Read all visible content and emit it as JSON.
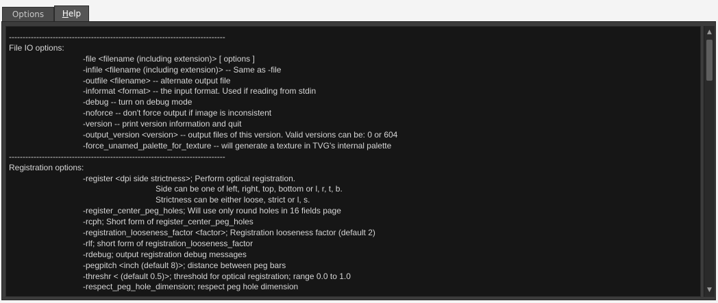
{
  "tabs": {
    "options_label": "Options",
    "help_prefix": "",
    "help_mnemonic": "H",
    "help_rest": "elp"
  },
  "help_lines": [
    {
      "indent": 0,
      "text": "-------------------------------------------------------------------------------"
    },
    {
      "indent": 0,
      "text": "File IO options:"
    },
    {
      "indent": 1,
      "text": "-file <filename (including extension)> [ options ]"
    },
    {
      "indent": 1,
      "text": "-infile <filename (including extension)> -- Same as -file"
    },
    {
      "indent": 1,
      "text": "-outfile <filename> -- alternate output file"
    },
    {
      "indent": 1,
      "text": "-informat <format> -- the input format. Used if reading from stdin"
    },
    {
      "indent": 1,
      "text": "-debug -- turn on debug mode"
    },
    {
      "indent": 1,
      "text": "-noforce -- don't force output if image is inconsistent"
    },
    {
      "indent": 1,
      "text": "-version -- print version information and quit"
    },
    {
      "indent": 1,
      "text": "-output_version <version> -- output files of this version. Valid versions can be: 0 or 604"
    },
    {
      "indent": 1,
      "text": "-force_unamed_palette_for_texture -- will generate a texture in TVG's internal palette"
    },
    {
      "indent": 0,
      "text": "-------------------------------------------------------------------------------"
    },
    {
      "indent": 0,
      "text": "Registration options:"
    },
    {
      "indent": 1,
      "text": "-register <dpi side strictness>; Perform optical registration."
    },
    {
      "indent": 2,
      "text": "Side can be one of left, right, top, bottom or l, r, t, b."
    },
    {
      "indent": 2,
      "text": "Strictness can be either loose, strict or l, s."
    },
    {
      "indent": 1,
      "text": "-register_center_peg_holes; Will use only round holes in 16 fields page"
    },
    {
      "indent": 1,
      "text": "-rcph; Short form of register_center_peg_holes"
    },
    {
      "indent": 1,
      "text": "-registration_looseness_factor <factor>; Registration looseness factor (default 2)"
    },
    {
      "indent": 1,
      "text": "-rlf; short form of registration_looseness_factor"
    },
    {
      "indent": 1,
      "text": "-rdebug; output registration debug messages"
    },
    {
      "indent": 1,
      "text": "-pegpitch <inch (default 8)>; distance between peg bars"
    },
    {
      "indent": 1,
      "text": "-threshr < (default 0.5)>; threshold for optical registration; range 0.0 to 1.0"
    },
    {
      "indent": 1,
      "text": "-respect_peg_hole_dimension; respect peg hole dimension"
    }
  ],
  "scrollbar": {
    "up_icon": "▲",
    "down_icon": "▼"
  }
}
